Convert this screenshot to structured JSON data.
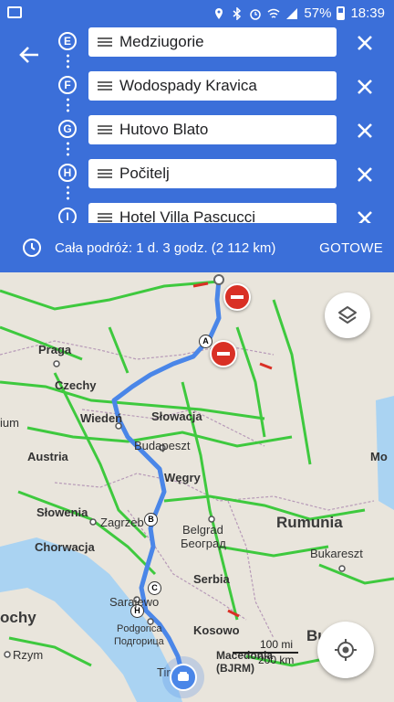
{
  "status_bar": {
    "battery": "57%",
    "time": "18:39"
  },
  "route": {
    "stops": [
      {
        "letter": "E",
        "name": "Medziugorie"
      },
      {
        "letter": "F",
        "name": "Wodospady Kravica"
      },
      {
        "letter": "G",
        "name": "Hutovo Blato"
      },
      {
        "letter": "H",
        "name": "Počitelj"
      },
      {
        "letter": "I",
        "name": "Hotel Villa Pascucci"
      }
    ]
  },
  "summary": {
    "trip_text": "Cała podróż: 1 d. 3 godz.  (2 112 km)",
    "done_label": "GOTOWE"
  },
  "map": {
    "labels": {
      "praga": "Praga",
      "czechy": "Czechy",
      "wieden": "Wiedeń",
      "slowacja": "Słowacja",
      "austria": "Austria",
      "budapeszt": "Budapeszt",
      "wegry": "Węgry",
      "slowenia": "Słowenia",
      "zagrzeb": "Zagrzeb",
      "chorwacja": "Chorwacja",
      "belgrad": "Belgrad",
      "belgrad_cyr": "Београд",
      "rumunia": "Rumunia",
      "bukareszt": "Bukareszt",
      "serbia": "Serbia",
      "sarajewo": "Sarajewo",
      "podgorica": "Podgorica",
      "podgorica_cyr": "Подгорица",
      "kosowo": "Kosowo",
      "rzym": "Rzym",
      "wlochy": "ochy",
      "tirana": "Tira",
      "macedonia": "Macedonia",
      "bjrm": "(BJRM)",
      "bul": "Buł",
      "mol": "Mo",
      "ium": "ium"
    },
    "markers": [
      "A",
      "B",
      "C",
      "H"
    ],
    "scale": {
      "miles": "100 mi",
      "km": "200 km"
    },
    "colors": {
      "route": "#4a86e8",
      "traffic_green": "#3ec93e",
      "traffic_red": "#d93025",
      "land": "#e9e5dc",
      "water": "#aad3f2"
    }
  }
}
